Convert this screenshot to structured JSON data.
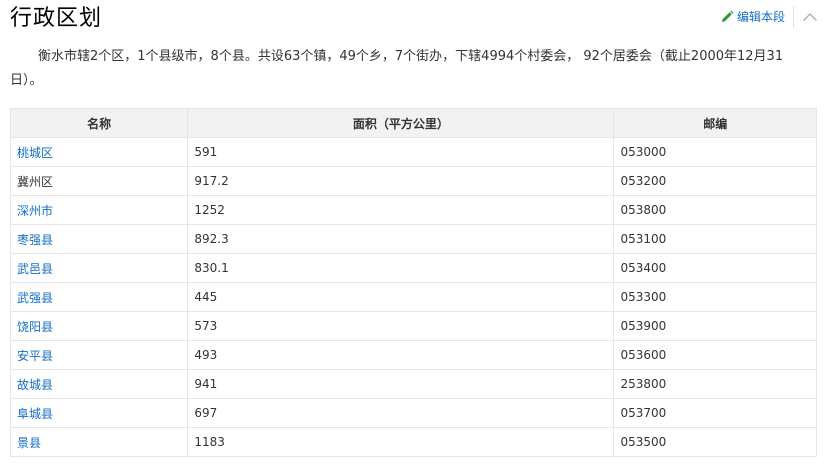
{
  "section": {
    "title": "行政区划",
    "edit_label": "编辑本段",
    "paragraph": "衡水市辖2个区，1个县级市，8个县。共设63个镇，49个乡，7个街办，下辖4994个村委会， 92个居委会（截止2000年12月31日）。"
  },
  "icons": {
    "edit": "pencil-icon",
    "collapse": "chevron-up-icon"
  },
  "colors": {
    "link": "#136ec2",
    "header_bg": "#f2f2f2",
    "border": "#e6e6e6"
  },
  "table": {
    "headers": [
      "名称",
      "面积（平方公里）",
      "邮编"
    ],
    "rows": [
      {
        "name": "桃城区",
        "area": "591",
        "zip": "053000",
        "link": true
      },
      {
        "name": "冀州区",
        "area": "917.2",
        "zip": "053200",
        "link": false
      },
      {
        "name": "深州市",
        "area": "1252",
        "zip": "053800",
        "link": true
      },
      {
        "name": "枣强县",
        "area": "892.3",
        "zip": "053100",
        "link": true
      },
      {
        "name": "武邑县",
        "area": "830.1",
        "zip": "053400",
        "link": true
      },
      {
        "name": "武强县",
        "area": "445",
        "zip": "053300",
        "link": true
      },
      {
        "name": "饶阳县",
        "area": "573",
        "zip": "053900",
        "link": true
      },
      {
        "name": "安平县",
        "area": "493",
        "zip": "053600",
        "link": true
      },
      {
        "name": "故城县",
        "area": "941",
        "zip": "253800",
        "link": true
      },
      {
        "name": "阜城县",
        "area": "697",
        "zip": "053700",
        "link": true
      },
      {
        "name": "景县",
        "area": "1183",
        "zip": "053500",
        "link": true
      }
    ]
  }
}
